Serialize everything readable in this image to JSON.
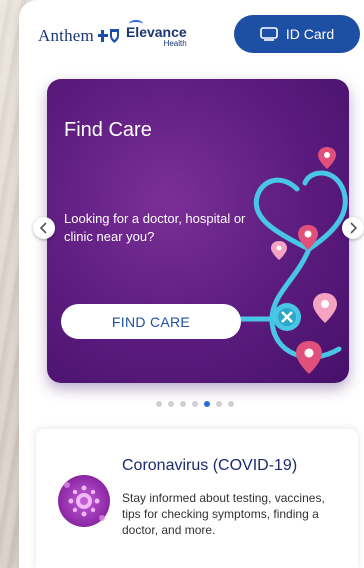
{
  "header": {
    "anthem_logo_text": "Anthem",
    "elevance_name": "Elevance",
    "elevance_sub": "Health",
    "id_card_label": "ID Card"
  },
  "carousel": {
    "slide_title": "Find Care",
    "slide_text": "Looking for a doctor, hospital or clinic near you?",
    "button_label": "FIND CARE",
    "total_slides": 7,
    "active_slide_index": 4
  },
  "info_card": {
    "title": "Coronavirus (COVID-19)",
    "body": "Stay informed about testing, vaccines, tips for checking symptoms, finding a doctor, and more."
  },
  "colors": {
    "brand_blue": "#1d4fa5",
    "carousel_purple": "#5b1b7e",
    "stethoscope_teal": "#49c6e5",
    "pin_pink": "#e0507a"
  }
}
